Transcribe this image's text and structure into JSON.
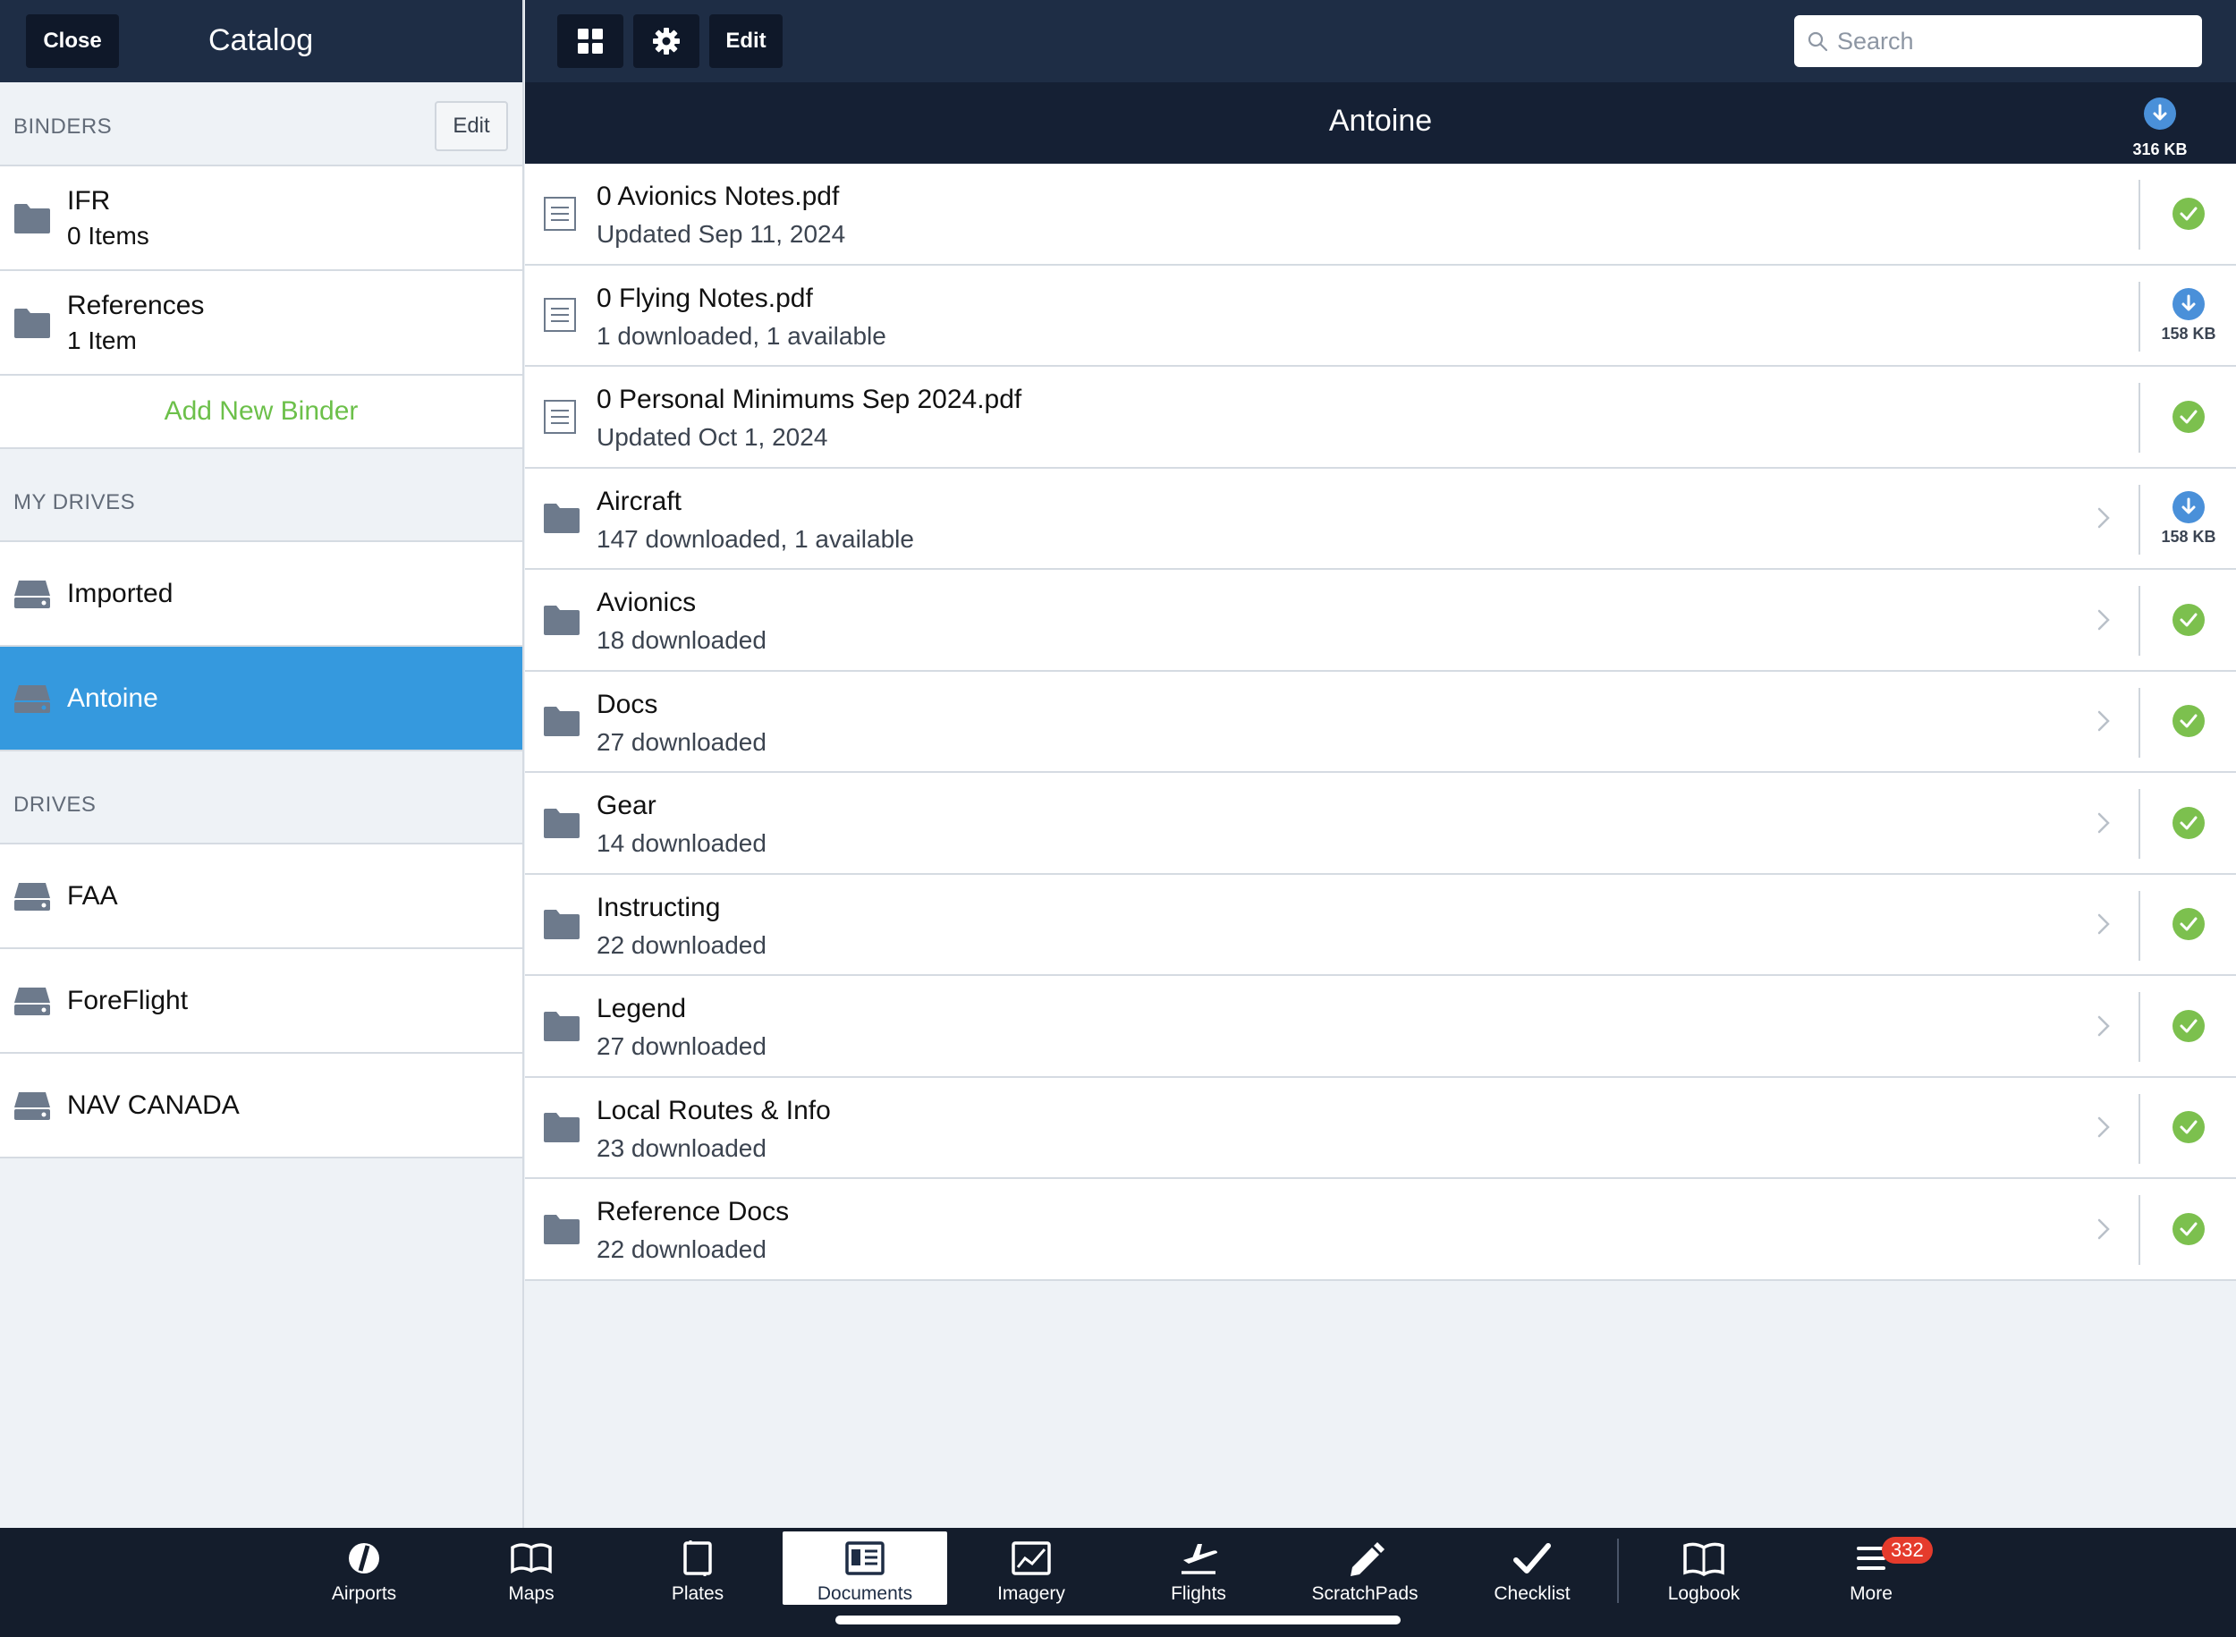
{
  "sidebar": {
    "close_label": "Close",
    "title": "Catalog",
    "binders_label": "BINDERS",
    "binders_edit": "Edit",
    "binders": [
      {
        "name": "IFR",
        "count": "0 Items"
      },
      {
        "name": "References",
        "count": "1 Item"
      }
    ],
    "add_binder": "Add New Binder",
    "my_drives_label": "MY DRIVES",
    "my_drives": [
      {
        "name": "Imported"
      },
      {
        "name": "Antoine",
        "selected": true
      }
    ],
    "drives_label": "DRIVES",
    "drives": [
      {
        "name": "FAA"
      },
      {
        "name": "ForeFlight"
      },
      {
        "name": "NAV CANADA"
      }
    ]
  },
  "toolbar": {
    "edit_label": "Edit",
    "search_placeholder": "Search"
  },
  "path": {
    "title": "Antoine",
    "download_size": "316 KB"
  },
  "items": [
    {
      "type": "file",
      "name": "0 Avionics Notes.pdf",
      "sub": "Updated Sep 11, 2024",
      "status": "downloaded"
    },
    {
      "type": "file",
      "name": "0 Flying Notes.pdf",
      "sub": "1 downloaded, 1 available",
      "status": "download",
      "size": "158 KB"
    },
    {
      "type": "file",
      "name": "0 Personal Minimums Sep 2024.pdf",
      "sub": "Updated Oct 1, 2024",
      "status": "downloaded"
    },
    {
      "type": "folder",
      "name": "Aircraft",
      "sub": "147 downloaded, 1 available",
      "status": "download",
      "size": "158 KB"
    },
    {
      "type": "folder",
      "name": "Avionics",
      "sub": "18 downloaded",
      "status": "downloaded"
    },
    {
      "type": "folder",
      "name": "Docs",
      "sub": "27 downloaded",
      "status": "downloaded"
    },
    {
      "type": "folder",
      "name": "Gear",
      "sub": "14 downloaded",
      "status": "downloaded"
    },
    {
      "type": "folder",
      "name": "Instructing",
      "sub": "22 downloaded",
      "status": "downloaded"
    },
    {
      "type": "folder",
      "name": "Legend",
      "sub": "27 downloaded",
      "status": "downloaded"
    },
    {
      "type": "folder",
      "name": "Local Routes & Info",
      "sub": "23 downloaded",
      "status": "downloaded"
    },
    {
      "type": "folder",
      "name": "Reference Docs",
      "sub": "22 downloaded",
      "status": "downloaded"
    }
  ],
  "tabs": [
    {
      "label": "Airports",
      "icon": "airports-icon"
    },
    {
      "label": "Maps",
      "icon": "maps-icon"
    },
    {
      "label": "Plates",
      "icon": "plates-icon"
    },
    {
      "label": "Documents",
      "icon": "documents-icon",
      "active": true
    },
    {
      "label": "Imagery",
      "icon": "imagery-icon"
    },
    {
      "label": "Flights",
      "icon": "flights-icon"
    },
    {
      "label": "ScratchPads",
      "icon": "scratchpads-icon"
    },
    {
      "label": "Checklist",
      "icon": "checklist-icon"
    },
    {
      "label": "Logbook",
      "icon": "logbook-icon"
    },
    {
      "label": "More",
      "icon": "more-icon",
      "badge": "332"
    }
  ],
  "colors": {
    "header": "#1e2d45",
    "path_bar": "#152034",
    "selected": "#3599de",
    "success": "#7cc04e",
    "download": "#4a90d9",
    "add_binder": "#6cc04a",
    "badge": "#e53b2c"
  }
}
